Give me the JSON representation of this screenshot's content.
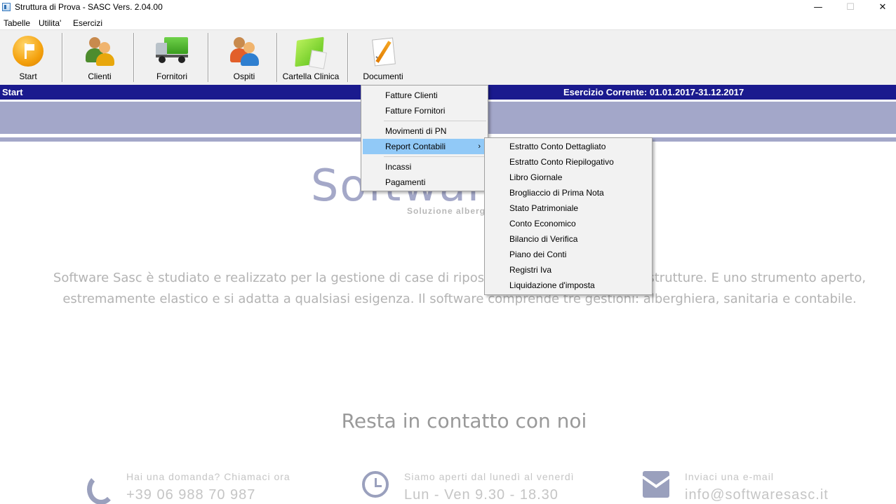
{
  "window": {
    "title": "Struttura di Prova - SASC Vers. 2.04.00",
    "minimize_glyph": "—",
    "maximize_glyph": "☐",
    "close_glyph": "✕"
  },
  "menubar": {
    "items": [
      "Tabelle",
      "Utilita'",
      "Esercizi"
    ]
  },
  "toolbar": {
    "buttons": [
      {
        "label": "Start",
        "icon": "start-flag-icon"
      },
      {
        "label": "Clienti",
        "icon": "clients-icon"
      },
      {
        "label": "Fornitori",
        "icon": "truck-icon"
      },
      {
        "label": "Ospiti",
        "icon": "guests-icon"
      },
      {
        "label": "Cartella Clinica",
        "icon": "medical-folder-icon"
      },
      {
        "label": "Documenti",
        "icon": "document-icon"
      }
    ]
  },
  "header": {
    "section": "Start",
    "esercizio": "Esercizio Corrente: 01.01.2017-31.12.2017"
  },
  "documenti_menu": {
    "items": [
      "Fatture Clienti",
      "Fatture Fornitori",
      "Movimenti di PN",
      "Report Contabili",
      "Incassi",
      "Pagamenti"
    ],
    "submenu_arrow": "›",
    "highlighted": "Report Contabili"
  },
  "report_contabili_menu": {
    "items": [
      "Estratto Conto Dettagliato",
      "Estratto Conto Riepilogativo",
      "Libro Giornale",
      "Brogliaccio di Prima Nota",
      "Stato Patrimoniale",
      "Conto Economico",
      "Bilancio di Verifica",
      "Piano dei Conti",
      "Registri Iva",
      "Liquidazione d'imposta"
    ]
  },
  "page": {
    "brand": "Software",
    "brand_sub": "Soluzione alberghiera",
    "description_line1": "Software Sasc è studiato e realizzato per la gestione di case di riposo e di diverse tipologie di strutture. E uno strumento aperto,",
    "description_line2": "estremamente elastico e si adatta a qualsiasi esigenza. Il software comprende tre gestioni: alberghiera, sanitaria e contabile.",
    "contact_title": "Resta in contatto con noi",
    "contacts": [
      {
        "caption": "Hai una domanda? Chiamaci ora",
        "value": "+39 06 988 70 987",
        "icon": "phone-icon"
      },
      {
        "caption": "Siamo aperti dal lunedì al venerdì",
        "value": "Lun - Ven 9.30 - 18.30",
        "icon": "clock-icon"
      },
      {
        "caption": "Inviaci una e-mail",
        "value": "info@softwaresasc.it",
        "icon": "mail-icon"
      }
    ]
  }
}
